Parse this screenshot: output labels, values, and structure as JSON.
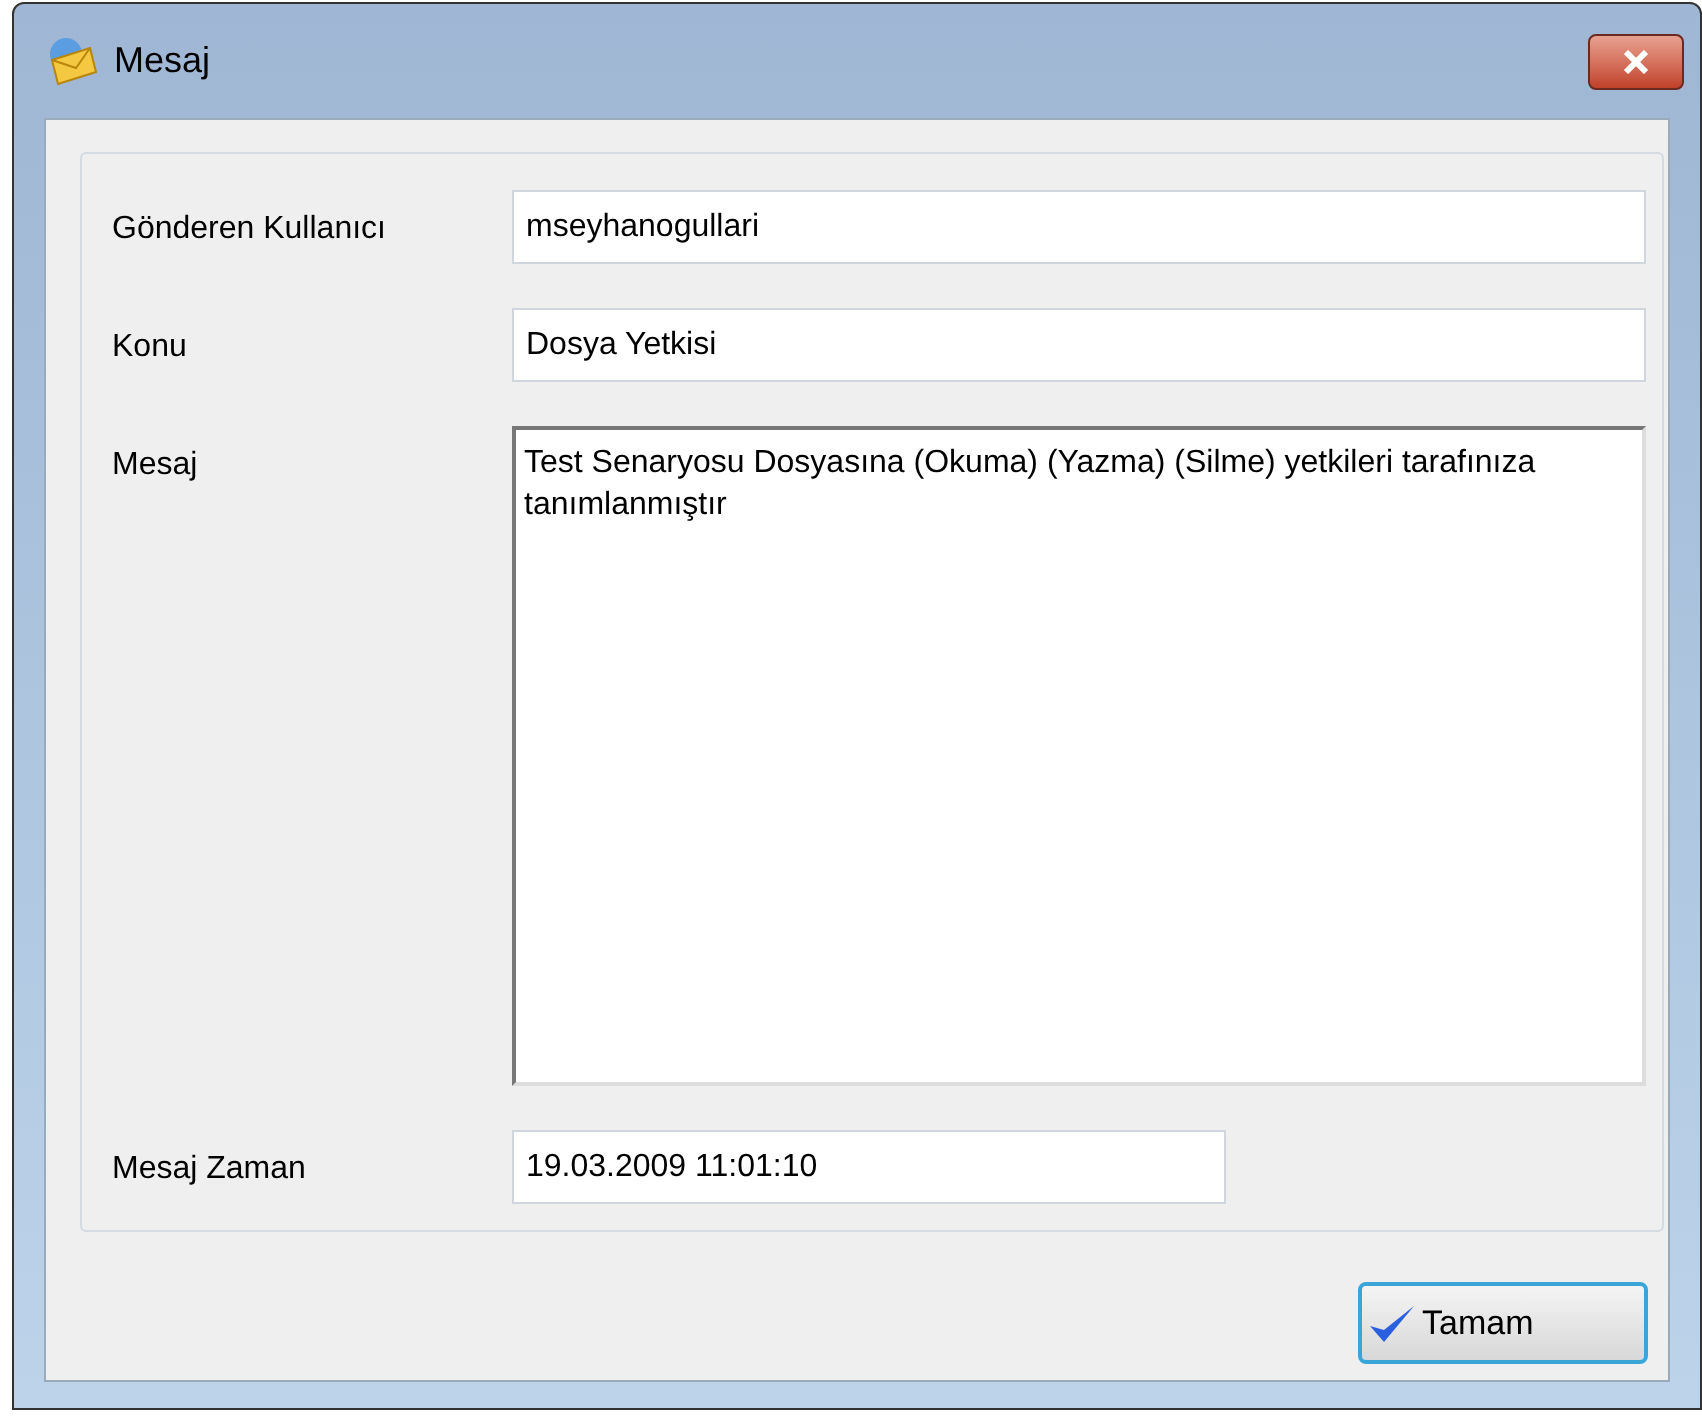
{
  "window": {
    "title": "Mesaj"
  },
  "fields": [
    {
      "kind": "input",
      "label": "Gönderen Kullanıcı",
      "value": "mseyhanogullari"
    },
    {
      "kind": "input",
      "label": "Konu",
      "value": "Dosya Yetkisi"
    },
    {
      "kind": "textarea",
      "label": "Mesaj",
      "value": "Test Senaryosu Dosyasına (Okuma) (Yazma) (Silme) yetkileri tarafınıza tanımlanmıştır"
    },
    {
      "kind": "short",
      "label": "Mesaj Zaman",
      "value": "19.03.2009 11:01:10"
    }
  ],
  "buttons": [
    {
      "label": "Tamam"
    }
  ]
}
